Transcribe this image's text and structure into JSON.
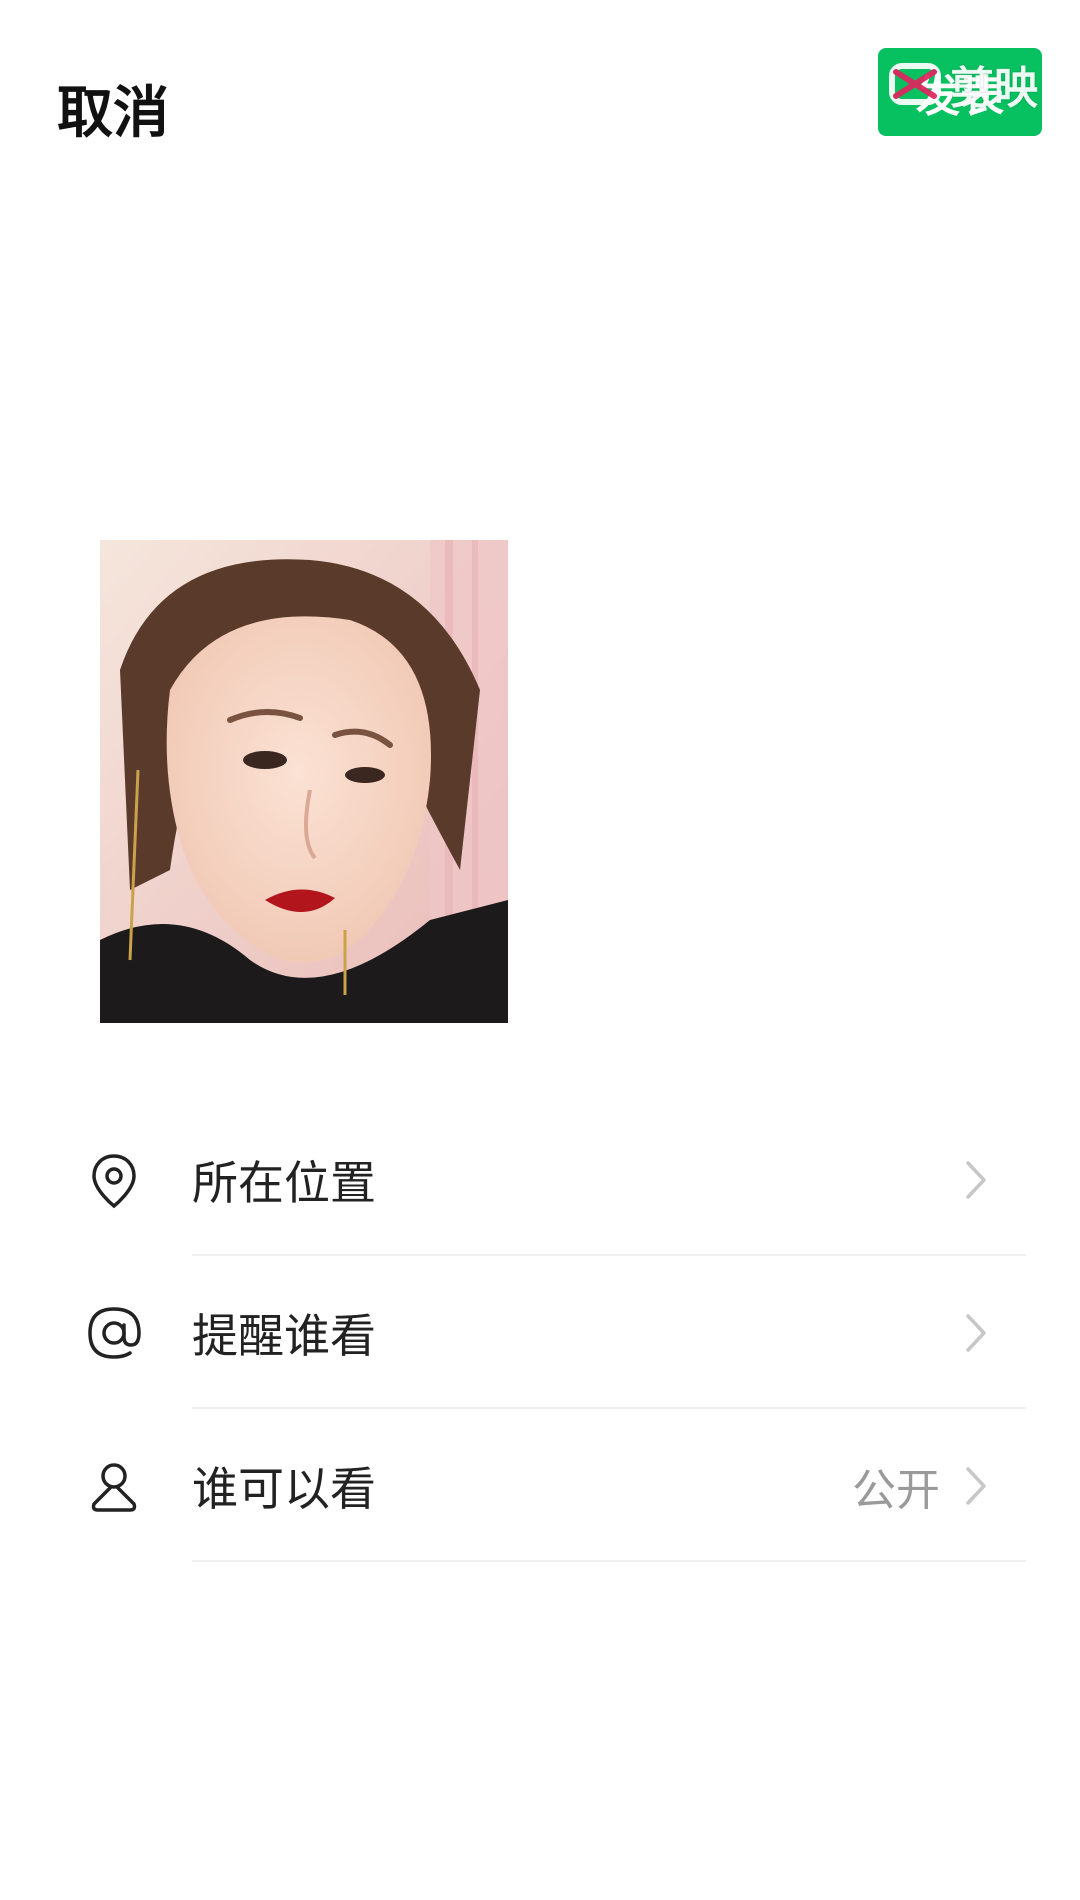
{
  "header": {
    "cancel_label": "取消",
    "publish_label": "发表",
    "watermark_label": "剪映"
  },
  "composer": {
    "text_value": ""
  },
  "options": [
    {
      "label": "所在位置",
      "icon": "location-pin-icon",
      "value": ""
    },
    {
      "label": "提醒谁看",
      "icon": "at-icon",
      "value": ""
    },
    {
      "label": "谁可以看",
      "icon": "person-icon",
      "value": "公开"
    }
  ],
  "colors": {
    "accent": "#07c160",
    "background": "#ffffff",
    "secondary_text": "#9a9a9a"
  }
}
